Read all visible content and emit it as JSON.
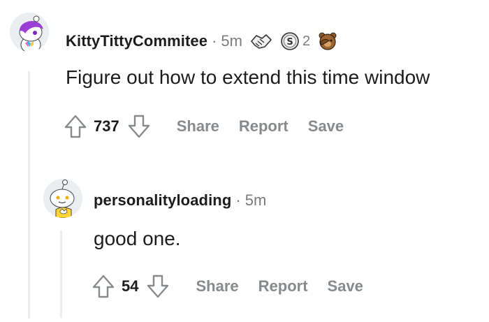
{
  "comments": [
    {
      "username": "KittyTittyCommitee",
      "separator": "·",
      "time": "5m",
      "awards": [
        {
          "icon": "handshake-award-icon"
        },
        {
          "icon": "silver-coin-award-icon",
          "count": "2"
        },
        {
          "icon": "facepalm-bear-award-icon"
        }
      ],
      "body": "Figure out how to extend this time window",
      "score": "737",
      "actions": {
        "share": "Share",
        "report": "Report",
        "save": "Save"
      }
    },
    {
      "username": "personalityloading",
      "separator": "·",
      "time": "5m",
      "body": "good one.",
      "score": "54",
      "actions": {
        "share": "Share",
        "report": "Report",
        "save": "Save"
      }
    }
  ],
  "colors": {
    "text": "#1c1c1c",
    "muted": "#787c7e",
    "action": "#878a8c",
    "thread_line": "#ebedef"
  }
}
